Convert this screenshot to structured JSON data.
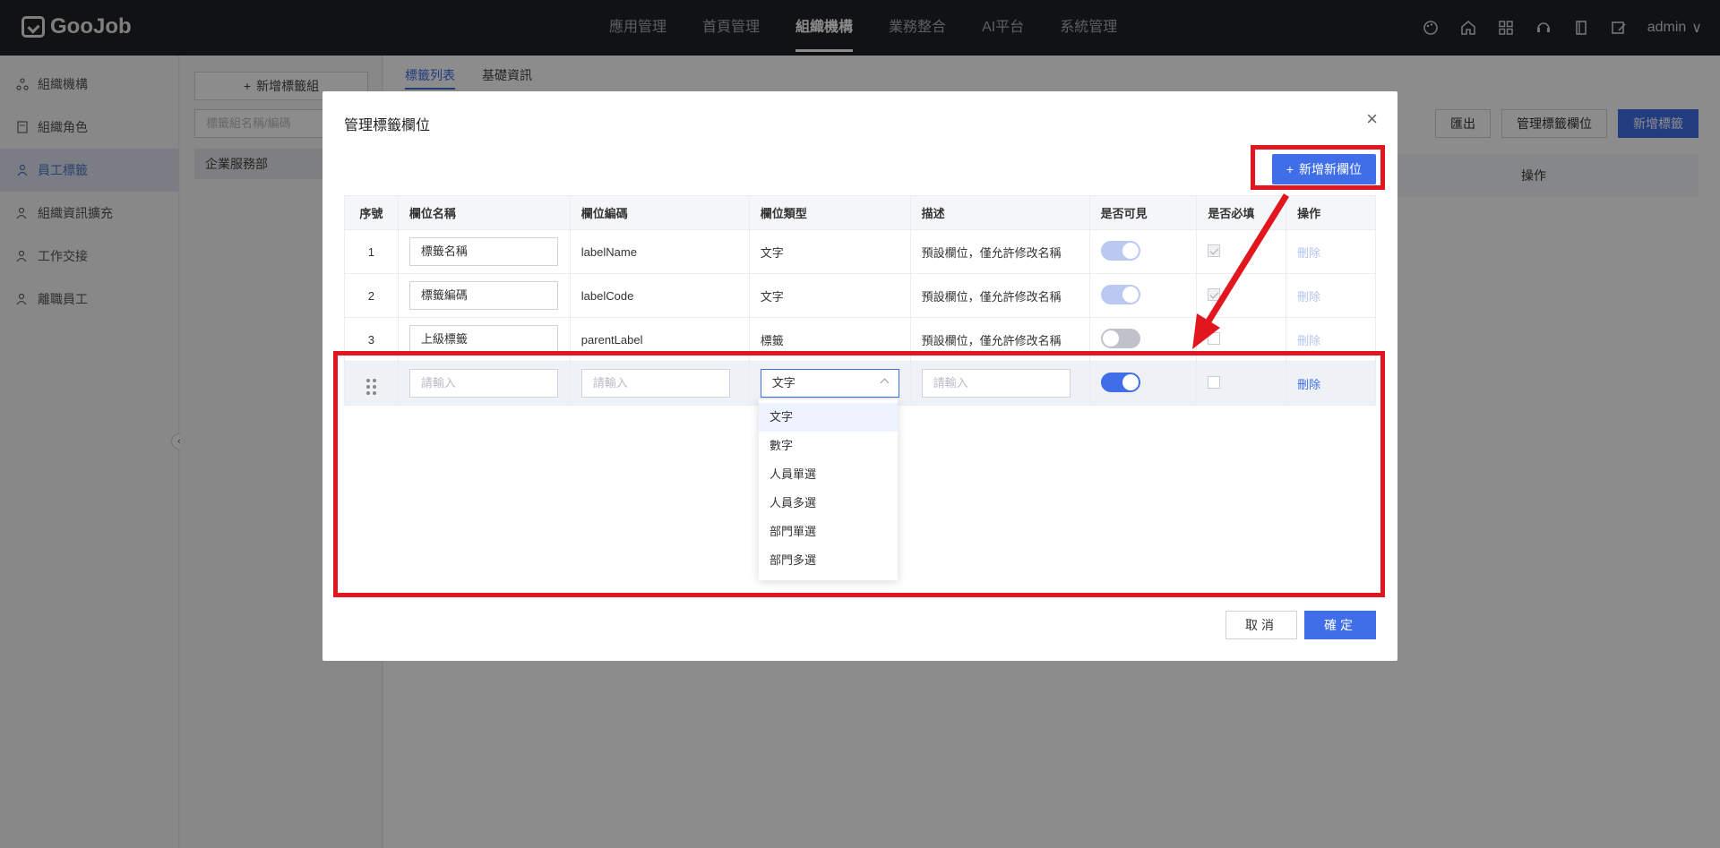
{
  "app": {
    "logo": "GooJob",
    "user": "admin"
  },
  "nav": [
    "應用管理",
    "首頁管理",
    "組織機構",
    "業務整合",
    "AI平台",
    "系統管理"
  ],
  "sidebar": {
    "items": [
      {
        "label": "組織機構",
        "icon": "org-icon"
      },
      {
        "label": "組織角色",
        "icon": "role-icon"
      },
      {
        "label": "員工標籤",
        "icon": "tag-icon",
        "active": true
      },
      {
        "label": "組織資訊擴充",
        "icon": "extend-icon"
      },
      {
        "label": "工作交接",
        "icon": "handover-icon"
      },
      {
        "label": "離職員工",
        "icon": "resign-icon"
      }
    ]
  },
  "groups": {
    "add_button": "新增標籤組",
    "search_placeholder": "標籤組名稱/編碼",
    "row": "企業服務部"
  },
  "main": {
    "tabs": [
      "標籤列表",
      "基礎資訊"
    ],
    "toolbar": {
      "export": "匯出",
      "manage_fields": "管理標籤欄位",
      "add_tag": "新增標籤"
    },
    "op_header": "操作"
  },
  "modal": {
    "title": "管理標籤欄位",
    "add_field_button": "新增新欄位",
    "headers": [
      "序號",
      "欄位名稱",
      "欄位編碼",
      "欄位類型",
      "描述",
      "是否可見",
      "是否必填",
      "操作"
    ],
    "rows": [
      {
        "index": "1",
        "name": "標籤名稱",
        "code": "labelName",
        "type": "文字",
        "desc": "預設欄位，僅允許修改名稱",
        "delete": "刪除"
      },
      {
        "index": "2",
        "name": "標籤編碼",
        "code": "labelCode",
        "type": "文字",
        "desc": "預設欄位，僅允許修改名稱",
        "delete": "刪除"
      },
      {
        "index": "3",
        "name": "上級標籤",
        "code": "parentLabel",
        "type": "標籤",
        "desc": "預設欄位，僅允許修改名稱",
        "delete": "刪除"
      }
    ],
    "new_row": {
      "name_placeholder": "請輸入",
      "code_placeholder": "請輸入",
      "type_value": "文字",
      "desc_placeholder": "請輸入",
      "delete": "刪除"
    },
    "type_options": [
      "文字",
      "數字",
      "人員單選",
      "人員多選",
      "部門單選",
      "部門多選"
    ],
    "cancel": "取消",
    "confirm": "確定"
  },
  "colors": {
    "primary": "#3f6ee8",
    "annotation": "#e2161f",
    "topbar": "#1f2126"
  }
}
